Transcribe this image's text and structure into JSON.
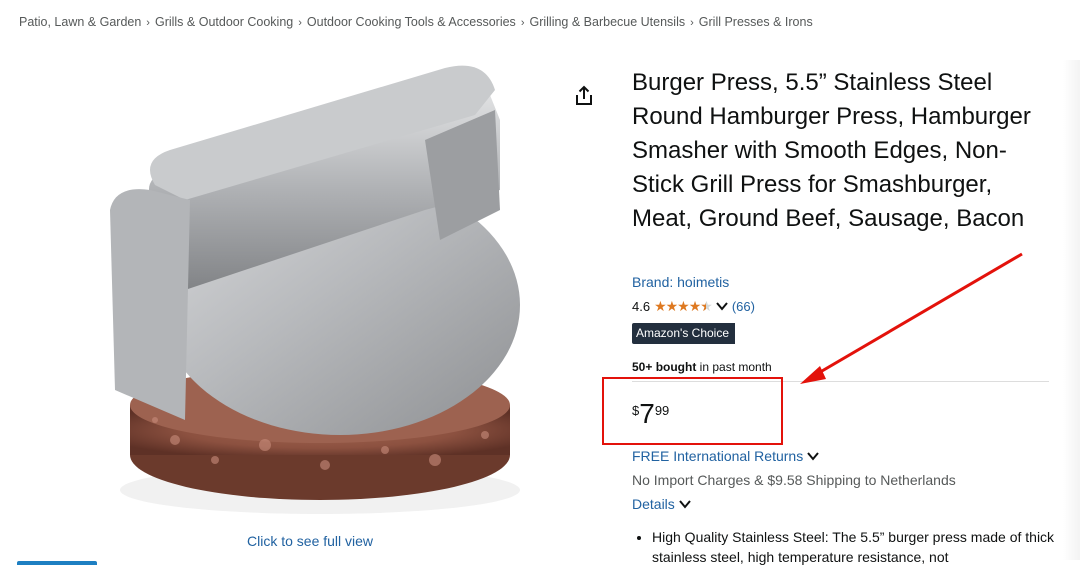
{
  "breadcrumb": {
    "items": [
      "Patio, Lawn & Garden",
      "Grills & Outdoor Cooking",
      "Outdoor Cooking Tools & Accessories",
      "Grilling & Barbecue Utensils",
      "Grill Presses & Irons"
    ],
    "separator": "›"
  },
  "image": {
    "see_full_label": "Click to see full view"
  },
  "product": {
    "title": "Burger Press, 5.5” Stainless Steel Round Hamburger Press, Hamburger Smasher with Smooth Edges, Non-Stick Grill Press for Smashburger, Meat, Ground Beef, Sausage, Bacon",
    "brand": "Brand: hoimetis",
    "rating_value": "4.6",
    "rating_stars": 4.5,
    "rating_count": "(66)",
    "badge": "Amazon's Choice",
    "bought_bold": "50+ bought",
    "bought_rest": " in past month",
    "price_symbol": "$",
    "price_whole": "7",
    "price_fraction": "99",
    "returns_label": "FREE International Returns",
    "shipping_text": "No Import Charges & $9.58 Shipping to Netherlands",
    "details_label": "Details",
    "bullet_1": "High Quality Stainless Steel: The 5.5” burger press made of thick stainless steel, high temperature resistance, not"
  },
  "colors": {
    "link": "#2162a1",
    "star": "#de7921",
    "badge_bg": "#232f3e",
    "annotation": "#e3120b"
  },
  "icons": {
    "share": "share-icon",
    "chevron": "chevron-down-icon",
    "star": "star-icon"
  }
}
